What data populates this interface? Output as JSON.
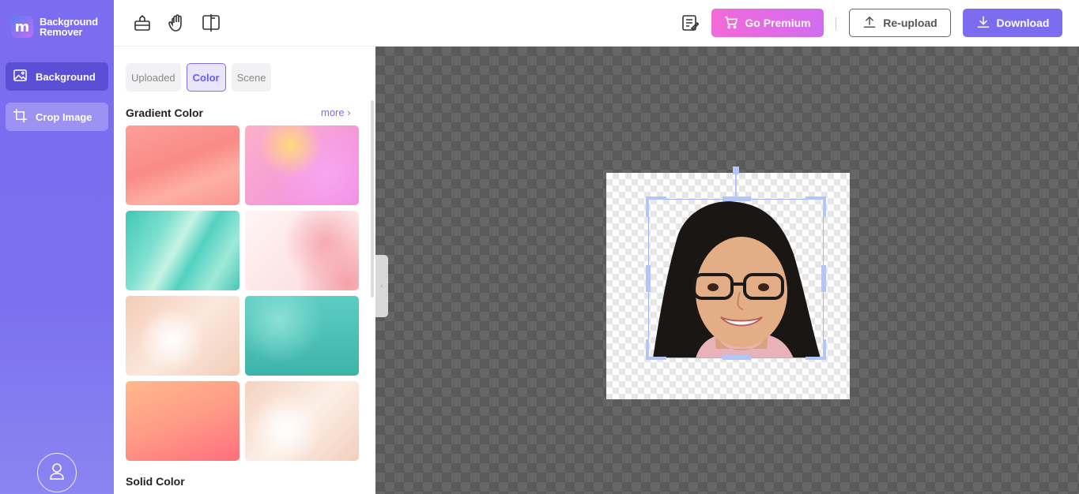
{
  "app": {
    "name_line1": "Background",
    "name_line2": "Remover",
    "logo_letter": "m"
  },
  "rail": {
    "items": [
      {
        "label": "Background",
        "icon": "image-icon",
        "active": true
      },
      {
        "label": "Crop Image",
        "icon": "crop-icon",
        "active": false
      }
    ],
    "avatar_icon": "user-icon"
  },
  "toolbar": {
    "tools": [
      "eraser-icon",
      "hand-icon",
      "compare-icon"
    ],
    "notes_icon": "notes-icon",
    "premium_label": "Go Premium",
    "reupload_label": "Re-upload",
    "download_label": "Download"
  },
  "panel": {
    "tabs": [
      {
        "label": "Uploaded",
        "active": false
      },
      {
        "label": "Color",
        "active": true
      },
      {
        "label": "Scene",
        "active": false
      }
    ],
    "gradient_title": "Gradient Color",
    "more_label": "more",
    "swatches": [
      {
        "name": "coral-wave",
        "colors": [
          "#f98f8a",
          "#fcaa9d"
        ]
      },
      {
        "name": "pink-yellow-haze",
        "colors": [
          "#fcb3df",
          "#f48ce8"
        ]
      },
      {
        "name": "teal-silk",
        "colors": [
          "#4ecfc0",
          "#a6eadc"
        ]
      },
      {
        "name": "rose-petals",
        "colors": [
          "#fde6e6",
          "#f4a6ad"
        ]
      },
      {
        "name": "peach-cloud",
        "colors": [
          "#f5d7c7",
          "#fdf1ea"
        ]
      },
      {
        "name": "teal-bokeh",
        "colors": [
          "#55ccc1",
          "#3fb6ab"
        ]
      },
      {
        "name": "coral-sunset",
        "colors": [
          "#ffa98a",
          "#ff7d7f"
        ]
      },
      {
        "name": "peach-watercolor",
        "colors": [
          "#f6d8c8",
          "#fdf2ea"
        ]
      }
    ],
    "solid_title": "Solid Color"
  },
  "colors": {
    "accent": "#7c6cf0",
    "rail": "#7b6cf0",
    "premium": "#f26ad8"
  }
}
